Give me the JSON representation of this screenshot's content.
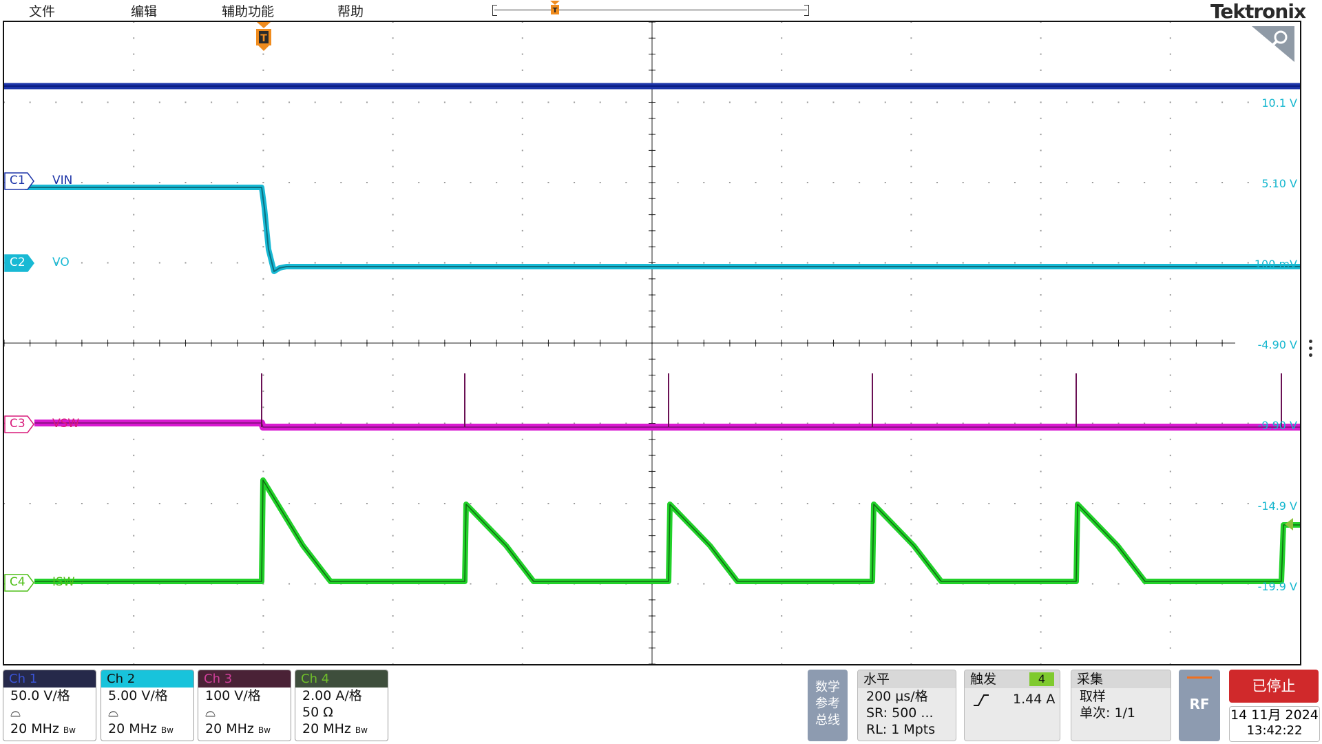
{
  "menu": {
    "items": [
      "文件",
      "编辑",
      "辅助功能",
      "帮助"
    ],
    "logo": "Tektronix"
  },
  "colors": {
    "ch1": "#1c34a8",
    "ch2": "#18b9d4",
    "ch3": "#d81ad0",
    "ch4": "#22d12a",
    "trigger": "#f08c1e"
  },
  "screen": {
    "zoom_icon": "magnifier-icon",
    "offset_labels": [
      "10.1 V",
      "5.10 V",
      "100 mV",
      "-4.90 V",
      "-9.90 V",
      "-14.9 V",
      "-19.9 V"
    ],
    "traces": [
      {
        "tag": "C1",
        "name": "VIN"
      },
      {
        "tag": "C2",
        "name": "VO"
      },
      {
        "tag": "C3",
        "name": "VSW"
      },
      {
        "tag": "C4",
        "name": "ISW"
      }
    ]
  },
  "channels": [
    {
      "name": "Ch 1",
      "scale": "50.0 V/格",
      "bandwidth": "20 MHz",
      "bw_mark": "Bw"
    },
    {
      "name": "Ch 2",
      "scale": "5.00 V/格",
      "bandwidth": "20 MHz",
      "bw_mark": "Bw"
    },
    {
      "name": "Ch 3",
      "scale": "100 V/格",
      "bandwidth": "20 MHz",
      "bw_mark": "Bw"
    },
    {
      "name": "Ch 4",
      "scale": "2.00 A/格",
      "impedance": "50 Ω",
      "bandwidth": "20 MHz",
      "bw_mark": "Bw"
    }
  ],
  "math_ref_bus": "数学\n参考\n总线",
  "horizontal": {
    "title": "水平",
    "scale": "200 µs/格",
    "sample_rate": "SR: 500 ...",
    "record_length": "RL: 1 Mpts"
  },
  "trigger": {
    "title": "触发",
    "source": "4",
    "level": "1.44 A",
    "slope_icon": "rising-edge-icon"
  },
  "acquisition": {
    "title": "采集",
    "mode": "取样",
    "count": "单次: 1/1"
  },
  "rf_button": "RF",
  "run_status": "已停止",
  "date": "14 11月 2024",
  "time": "13:42:22"
}
